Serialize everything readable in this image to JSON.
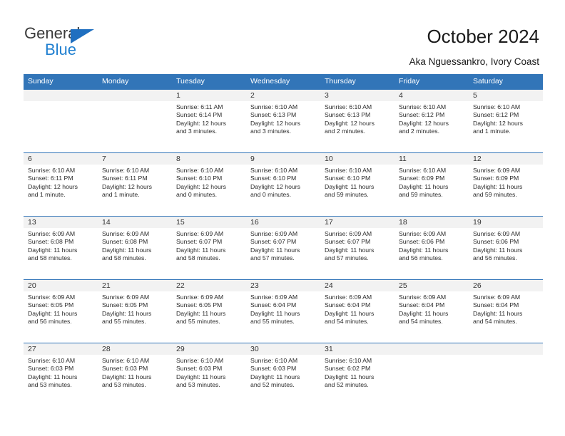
{
  "brand": {
    "name_top": "General",
    "name_bottom": "Blue",
    "triangle_color": "#1f6fc0",
    "blue_color": "#1f7fd0"
  },
  "header": {
    "title": "October 2024",
    "subtitle": "Aka Nguessankro, Ivory Coast"
  },
  "theme": {
    "header_blue": "#3275b8",
    "band_gray": "#f2f2f2",
    "text_dark": "#2b2b2b"
  },
  "weekdays": [
    "Sunday",
    "Monday",
    "Tuesday",
    "Wednesday",
    "Thursday",
    "Friday",
    "Saturday"
  ],
  "weeks": [
    [
      {
        "day": "",
        "sunrise": "",
        "sunset": "",
        "daylight1": "",
        "daylight2": ""
      },
      {
        "day": "",
        "sunrise": "",
        "sunset": "",
        "daylight1": "",
        "daylight2": ""
      },
      {
        "day": "1",
        "sunrise": "Sunrise: 6:11 AM",
        "sunset": "Sunset: 6:14 PM",
        "daylight1": "Daylight: 12 hours",
        "daylight2": "and 3 minutes."
      },
      {
        "day": "2",
        "sunrise": "Sunrise: 6:10 AM",
        "sunset": "Sunset: 6:13 PM",
        "daylight1": "Daylight: 12 hours",
        "daylight2": "and 3 minutes."
      },
      {
        "day": "3",
        "sunrise": "Sunrise: 6:10 AM",
        "sunset": "Sunset: 6:13 PM",
        "daylight1": "Daylight: 12 hours",
        "daylight2": "and 2 minutes."
      },
      {
        "day": "4",
        "sunrise": "Sunrise: 6:10 AM",
        "sunset": "Sunset: 6:12 PM",
        "daylight1": "Daylight: 12 hours",
        "daylight2": "and 2 minutes."
      },
      {
        "day": "5",
        "sunrise": "Sunrise: 6:10 AM",
        "sunset": "Sunset: 6:12 PM",
        "daylight1": "Daylight: 12 hours",
        "daylight2": "and 1 minute."
      }
    ],
    [
      {
        "day": "6",
        "sunrise": "Sunrise: 6:10 AM",
        "sunset": "Sunset: 6:11 PM",
        "daylight1": "Daylight: 12 hours",
        "daylight2": "and 1 minute."
      },
      {
        "day": "7",
        "sunrise": "Sunrise: 6:10 AM",
        "sunset": "Sunset: 6:11 PM",
        "daylight1": "Daylight: 12 hours",
        "daylight2": "and 1 minute."
      },
      {
        "day": "8",
        "sunrise": "Sunrise: 6:10 AM",
        "sunset": "Sunset: 6:10 PM",
        "daylight1": "Daylight: 12 hours",
        "daylight2": "and 0 minutes."
      },
      {
        "day": "9",
        "sunrise": "Sunrise: 6:10 AM",
        "sunset": "Sunset: 6:10 PM",
        "daylight1": "Daylight: 12 hours",
        "daylight2": "and 0 minutes."
      },
      {
        "day": "10",
        "sunrise": "Sunrise: 6:10 AM",
        "sunset": "Sunset: 6:10 PM",
        "daylight1": "Daylight: 11 hours",
        "daylight2": "and 59 minutes."
      },
      {
        "day": "11",
        "sunrise": "Sunrise: 6:10 AM",
        "sunset": "Sunset: 6:09 PM",
        "daylight1": "Daylight: 11 hours",
        "daylight2": "and 59 minutes."
      },
      {
        "day": "12",
        "sunrise": "Sunrise: 6:09 AM",
        "sunset": "Sunset: 6:09 PM",
        "daylight1": "Daylight: 11 hours",
        "daylight2": "and 59 minutes."
      }
    ],
    [
      {
        "day": "13",
        "sunrise": "Sunrise: 6:09 AM",
        "sunset": "Sunset: 6:08 PM",
        "daylight1": "Daylight: 11 hours",
        "daylight2": "and 58 minutes."
      },
      {
        "day": "14",
        "sunrise": "Sunrise: 6:09 AM",
        "sunset": "Sunset: 6:08 PM",
        "daylight1": "Daylight: 11 hours",
        "daylight2": "and 58 minutes."
      },
      {
        "day": "15",
        "sunrise": "Sunrise: 6:09 AM",
        "sunset": "Sunset: 6:07 PM",
        "daylight1": "Daylight: 11 hours",
        "daylight2": "and 58 minutes."
      },
      {
        "day": "16",
        "sunrise": "Sunrise: 6:09 AM",
        "sunset": "Sunset: 6:07 PM",
        "daylight1": "Daylight: 11 hours",
        "daylight2": "and 57 minutes."
      },
      {
        "day": "17",
        "sunrise": "Sunrise: 6:09 AM",
        "sunset": "Sunset: 6:07 PM",
        "daylight1": "Daylight: 11 hours",
        "daylight2": "and 57 minutes."
      },
      {
        "day": "18",
        "sunrise": "Sunrise: 6:09 AM",
        "sunset": "Sunset: 6:06 PM",
        "daylight1": "Daylight: 11 hours",
        "daylight2": "and 56 minutes."
      },
      {
        "day": "19",
        "sunrise": "Sunrise: 6:09 AM",
        "sunset": "Sunset: 6:06 PM",
        "daylight1": "Daylight: 11 hours",
        "daylight2": "and 56 minutes."
      }
    ],
    [
      {
        "day": "20",
        "sunrise": "Sunrise: 6:09 AM",
        "sunset": "Sunset: 6:05 PM",
        "daylight1": "Daylight: 11 hours",
        "daylight2": "and 56 minutes."
      },
      {
        "day": "21",
        "sunrise": "Sunrise: 6:09 AM",
        "sunset": "Sunset: 6:05 PM",
        "daylight1": "Daylight: 11 hours",
        "daylight2": "and 55 minutes."
      },
      {
        "day": "22",
        "sunrise": "Sunrise: 6:09 AM",
        "sunset": "Sunset: 6:05 PM",
        "daylight1": "Daylight: 11 hours",
        "daylight2": "and 55 minutes."
      },
      {
        "day": "23",
        "sunrise": "Sunrise: 6:09 AM",
        "sunset": "Sunset: 6:04 PM",
        "daylight1": "Daylight: 11 hours",
        "daylight2": "and 55 minutes."
      },
      {
        "day": "24",
        "sunrise": "Sunrise: 6:09 AM",
        "sunset": "Sunset: 6:04 PM",
        "daylight1": "Daylight: 11 hours",
        "daylight2": "and 54 minutes."
      },
      {
        "day": "25",
        "sunrise": "Sunrise: 6:09 AM",
        "sunset": "Sunset: 6:04 PM",
        "daylight1": "Daylight: 11 hours",
        "daylight2": "and 54 minutes."
      },
      {
        "day": "26",
        "sunrise": "Sunrise: 6:09 AM",
        "sunset": "Sunset: 6:04 PM",
        "daylight1": "Daylight: 11 hours",
        "daylight2": "and 54 minutes."
      }
    ],
    [
      {
        "day": "27",
        "sunrise": "Sunrise: 6:10 AM",
        "sunset": "Sunset: 6:03 PM",
        "daylight1": "Daylight: 11 hours",
        "daylight2": "and 53 minutes."
      },
      {
        "day": "28",
        "sunrise": "Sunrise: 6:10 AM",
        "sunset": "Sunset: 6:03 PM",
        "daylight1": "Daylight: 11 hours",
        "daylight2": "and 53 minutes."
      },
      {
        "day": "29",
        "sunrise": "Sunrise: 6:10 AM",
        "sunset": "Sunset: 6:03 PM",
        "daylight1": "Daylight: 11 hours",
        "daylight2": "and 53 minutes."
      },
      {
        "day": "30",
        "sunrise": "Sunrise: 6:10 AM",
        "sunset": "Sunset: 6:03 PM",
        "daylight1": "Daylight: 11 hours",
        "daylight2": "and 52 minutes."
      },
      {
        "day": "31",
        "sunrise": "Sunrise: 6:10 AM",
        "sunset": "Sunset: 6:02 PM",
        "daylight1": "Daylight: 11 hours",
        "daylight2": "and 52 minutes."
      },
      {
        "day": "",
        "sunrise": "",
        "sunset": "",
        "daylight1": "",
        "daylight2": ""
      },
      {
        "day": "",
        "sunrise": "",
        "sunset": "",
        "daylight1": "",
        "daylight2": ""
      }
    ]
  ]
}
